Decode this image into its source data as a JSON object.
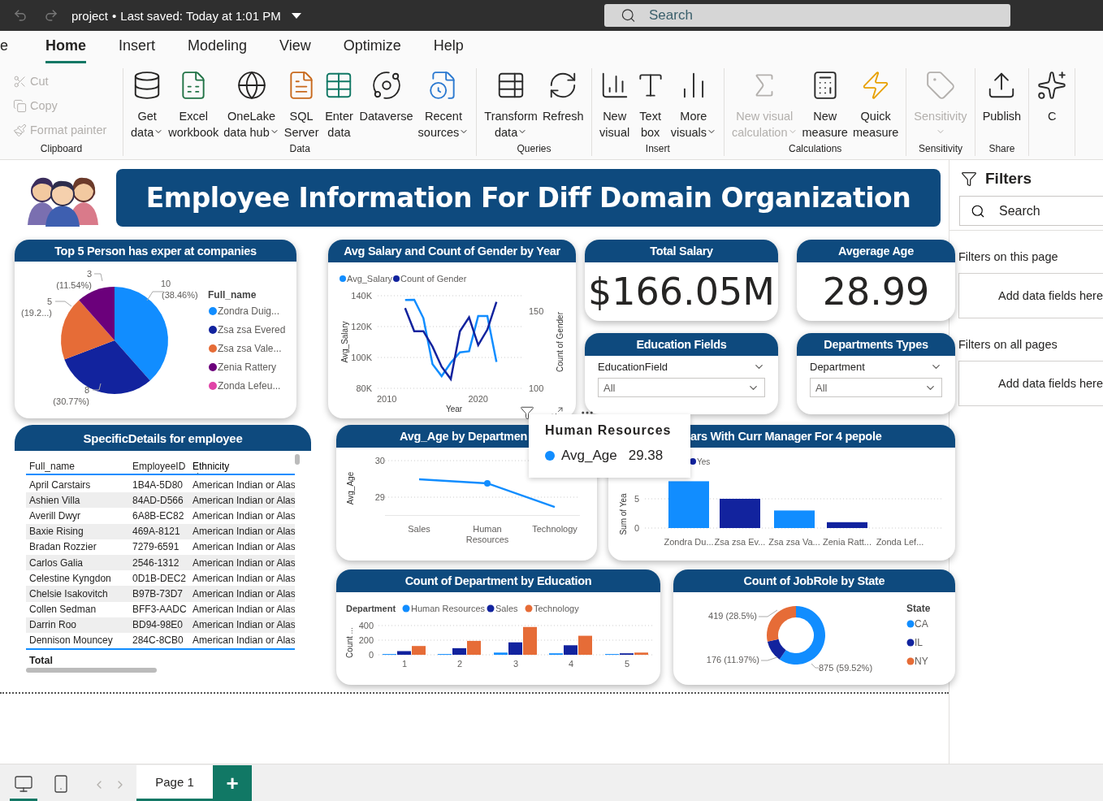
{
  "title_bar": {
    "file_name": "project",
    "separator": "•",
    "saved": "Last saved: Today at 1:01 PM",
    "search_placeholder": "Search"
  },
  "menu_tabs": [
    {
      "label": "e",
      "selected": false
    },
    {
      "label": "Home",
      "selected": true
    },
    {
      "label": "Insert",
      "selected": false
    },
    {
      "label": "Modeling",
      "selected": false
    },
    {
      "label": "View",
      "selected": false
    },
    {
      "label": "Optimize",
      "selected": false
    },
    {
      "label": "Help",
      "selected": false
    }
  ],
  "ribbon": {
    "groups": [
      {
        "label": "Clipboard",
        "kind": "small",
        "items": [
          {
            "lines": [
              "Cut"
            ],
            "dropdown": false,
            "disabled": true
          },
          {
            "lines": [
              "Copy"
            ],
            "dropdown": false,
            "disabled": true
          },
          {
            "lines": [
              "Format painter"
            ],
            "dropdown": false,
            "disabled": true
          }
        ]
      },
      {
        "label": "Data",
        "kind": "large",
        "items": [
          {
            "lines": [
              "Get",
              "data"
            ],
            "dropdown": true,
            "disabled": false
          },
          {
            "lines": [
              "Excel",
              "workbook"
            ],
            "dropdown": false,
            "disabled": false
          },
          {
            "lines": [
              "OneLake",
              "data hub"
            ],
            "dropdown": true,
            "disabled": false
          },
          {
            "lines": [
              "SQL",
              "Server"
            ],
            "dropdown": false,
            "disabled": false
          },
          {
            "lines": [
              "Enter",
              "data"
            ],
            "dropdown": false,
            "disabled": false
          },
          {
            "lines": [
              "Dataverse"
            ],
            "dropdown": false,
            "disabled": false
          },
          {
            "lines": [
              "Recent",
              "sources"
            ],
            "dropdown": true,
            "disabled": false
          }
        ]
      },
      {
        "label": "Queries",
        "kind": "large",
        "items": [
          {
            "lines": [
              "Transform",
              "data"
            ],
            "dropdown": true,
            "disabled": false
          },
          {
            "lines": [
              "Refresh"
            ],
            "dropdown": false,
            "disabled": false
          }
        ]
      },
      {
        "label": "Insert",
        "kind": "large",
        "items": [
          {
            "lines": [
              "New",
              "visual"
            ],
            "dropdown": false,
            "disabled": false
          },
          {
            "lines": [
              "Text",
              "box"
            ],
            "dropdown": false,
            "disabled": false
          },
          {
            "lines": [
              "More",
              "visuals"
            ],
            "dropdown": true,
            "disabled": false
          }
        ]
      },
      {
        "label": "Calculations",
        "kind": "large",
        "items": [
          {
            "lines": [
              "New visual",
              "calculation"
            ],
            "dropdown": true,
            "disabled": true
          },
          {
            "lines": [
              "New",
              "measure"
            ],
            "dropdown": false,
            "disabled": false
          },
          {
            "lines": [
              "Quick",
              "measure"
            ],
            "dropdown": false,
            "disabled": false
          }
        ]
      },
      {
        "label": "Sensitivity",
        "kind": "large",
        "items": [
          {
            "lines": [
              "Sensitivity"
            ],
            "dropdown": true,
            "disabled": true
          }
        ]
      },
      {
        "label": "Share",
        "kind": "large",
        "items": [
          {
            "lines": [
              "Publish"
            ],
            "dropdown": false,
            "disabled": false
          }
        ]
      },
      {
        "kind": "large",
        "items": [
          {
            "lines": [
              "C"
            ],
            "dropdown": false,
            "disabled": false
          }
        ]
      }
    ]
  },
  "report": {
    "banner": "Employee Information For Diff Domain Organization",
    "pie_card": {
      "title": "Top 5 Person has exper at companies",
      "legend_title": "Full_name",
      "chart_data": {
        "type": "pie",
        "categories": [
          "Zondra Duig...",
          "Zsa zsa Evered",
          "Zsa zsa Vale...",
          "Zenia Rattery",
          "Zonda Lefeu..."
        ],
        "legend": "right",
        "values": [
          38.46,
          30.77,
          19.23,
          11.54,
          0
        ],
        "colors": [
          "#118dff",
          "#12239e",
          "#e66c37",
          "#6b007b",
          "#e044a7"
        ],
        "value_labels": [
          {
            "value": "10",
            "share": "(38.46%)"
          },
          {
            "value": "8",
            "share": "(30.77%)"
          },
          {
            "value": "5",
            "share": "(19.2...)"
          },
          {
            "value": "3",
            "share": "(11.54%)"
          },
          null
        ]
      }
    },
    "line_card": {
      "title": "Avg Salary and Count of Gender by Year",
      "chart_data": {
        "type": "line",
        "xlabel": "Year",
        "ylabel": "Avg_Salary",
        "y2label": "Count of Gender",
        "legend": "top",
        "x": [
          2012,
          2013,
          2014,
          2015,
          2016,
          2017,
          2018,
          2019,
          2020,
          2021,
          2022
        ],
        "xlim": [
          2009,
          2025
        ],
        "xticks": [
          2010,
          2020
        ],
        "ylim": [
          80000,
          140000
        ],
        "yticks": [
          {
            "value": 80000,
            "label": "80K"
          },
          {
            "value": 100000,
            "label": "100K"
          },
          {
            "value": 120000,
            "label": "120K"
          },
          {
            "value": 140000,
            "label": "140K"
          }
        ],
        "y2lim": [
          100,
          160
        ],
        "y2ticks": [
          100,
          150
        ],
        "series": [
          {
            "name": "Avg_Salary",
            "color": "#118dff",
            "values": [
              137200,
              137400,
              125500,
              95700,
              87900,
              96600,
              103300,
              104000,
              126900,
              126900,
              97100
            ]
          },
          {
            "name": "Count of Gender",
            "color": "#12239e",
            "axis": "y2",
            "values": [
              152,
              137,
              137,
              127,
              114,
              106,
              137,
              146,
              128,
              138,
              156
            ]
          }
        ]
      }
    },
    "kpis": [
      {
        "title": "Total Salary",
        "value": "$166.05M"
      },
      {
        "title": "Avgerage Age",
        "value": "28.99"
      }
    ],
    "slicers": [
      {
        "title": "Education Fields",
        "field": "EducationField",
        "value": "All"
      },
      {
        "title": "Departments Types",
        "field": "Department",
        "value": "All"
      }
    ],
    "table_card": {
      "title": "SpecificDetails for employee",
      "columns": [
        {
          "label": "Full_name",
          "sorted": false
        },
        {
          "label": "EmployeeID",
          "sorted": false
        },
        {
          "label": "Ethnicity",
          "sorted": true
        }
      ],
      "rows": [
        [
          "April Carstairs",
          "1B4A-5D80",
          "American Indian or Alas"
        ],
        [
          "Ashien Villa",
          "84AD-D566",
          "American Indian or Alas"
        ],
        [
          "Averill Dwyr",
          "6A8B-EC82",
          "American Indian or Alas"
        ],
        [
          "Baxie Rising",
          "469A-8121",
          "American Indian or Alas"
        ],
        [
          "Bradan Rozzier",
          "7279-6591",
          "American Indian or Alas"
        ],
        [
          "Carlos Galia",
          "2546-1312",
          "American Indian or Alas"
        ],
        [
          "Celestine Kyngdon",
          "0D1B-DEC2",
          "American Indian or Alas"
        ],
        [
          "Chelsie Isakovitch",
          "B97B-73D7",
          "American Indian or Alas"
        ],
        [
          "Collen Sedman",
          "BFF3-AADC",
          "American Indian or Alas"
        ],
        [
          "Darrin Roo",
          "BD94-98E0",
          "American Indian or Alas"
        ],
        [
          "Dennison Mouncey",
          "284C-8CB0",
          "American Indian or Alas"
        ]
      ],
      "total_label": "Total"
    },
    "age_card": {
      "title": "Avg_Age by Departmen",
      "chart_data": {
        "type": "line",
        "ylabel": "Avg_Age",
        "categories": [
          "Sales",
          "Human Resources",
          "Technology"
        ],
        "ylim": [
          28.5,
          30
        ],
        "yticks": [
          29,
          30
        ],
        "series": [
          {
            "name": "Avg_Age",
            "color": "#118dff",
            "values": [
              29.49,
              29.38,
              28.73
            ]
          }
        ]
      }
    },
    "tooltip": {
      "title": "Human Resources",
      "value": "29.38",
      "color": "#118dff"
    },
    "manager_card": {
      "title": "ars With Curr Manager For 4 pepole",
      "chart_data": {
        "type": "bar",
        "ylabel": "Sum of Yea",
        "categories": [
          "Zondra Du...",
          "Zsa zsa Ev...",
          "Zsa zsa Va...",
          "Zenia Ratt...",
          "Zonda Lef..."
        ],
        "colors": [
          "#118dff",
          "#12239e",
          "#118dff",
          "#12239e"
        ],
        "ylim": [
          0,
          8
        ],
        "yticks": [
          0,
          5
        ],
        "series": [
          {
            "name": "Yes",
            "values": [
              8,
              5,
              3,
              1,
              0
            ]
          }
        ]
      }
    },
    "education_card": {
      "title": "Count of Department by Education",
      "legend_title": "Department",
      "chart_data": {
        "type": "bar",
        "ylabel": "Count ...",
        "legend": "top",
        "categories": [
          "1",
          "2",
          "3",
          "4",
          "5"
        ],
        "ylim": [
          0,
          400
        ],
        "yticks": [
          0,
          200,
          400
        ],
        "series": [
          {
            "name": "Human Resources",
            "color": "#118dff",
            "values": [
              10,
              10,
              30,
              20,
              10
            ]
          },
          {
            "name": "Sales",
            "color": "#12239e",
            "values": [
              50,
              90,
              170,
              130,
              20
            ]
          },
          {
            "name": "Technology",
            "color": "#e66c37",
            "values": [
              120,
              190,
              380,
              260,
              30
            ]
          }
        ]
      }
    },
    "state_card": {
      "title": "Count of JobRole by State",
      "legend_title": "State",
      "chart_data": {
        "type": "donut",
        "legend": "right",
        "categories": [
          "CA",
          "IL",
          "NY"
        ],
        "values": [
          875,
          176,
          419
        ],
        "colors": [
          "#118dff",
          "#12239e",
          "#e66c37"
        ],
        "value_labels": [
          "875 (59.52%)",
          "176 (11.97%)",
          "419 (28.5%)"
        ]
      }
    }
  },
  "filters_pane": {
    "title": "Filters",
    "search_placeholder": "Search",
    "sections": [
      {
        "heading": "Filters on this page",
        "drop_hint": "Add data fields here"
      },
      {
        "heading": "Filters on all pages",
        "drop_hint": "Add data fields here"
      }
    ]
  },
  "bottom_bar": {
    "views": [
      {
        "kind": "desktop",
        "selected": true
      },
      {
        "kind": "mobile",
        "selected": false
      }
    ],
    "pages": [
      {
        "label": "Page 1",
        "selected": true
      }
    ],
    "add_label": "+"
  }
}
